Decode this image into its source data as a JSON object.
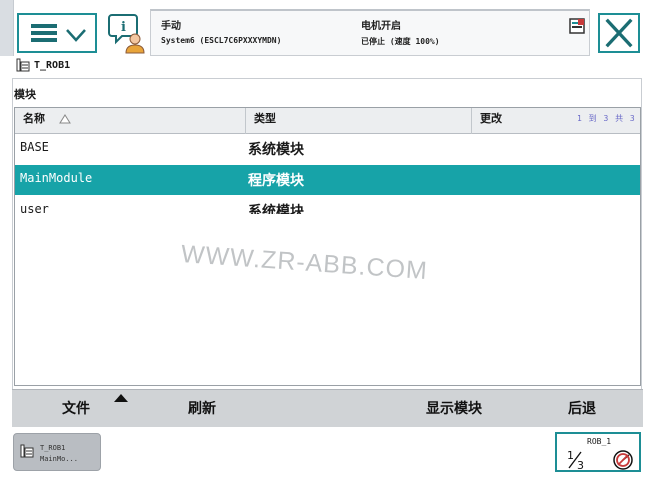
{
  "status": {
    "mode": "手动",
    "system": "System6 (ESCL7C6PXXXYMDN)",
    "motor": "电机开启",
    "state": "已停止 (速度 100%)"
  },
  "task": {
    "name": "T_ROB1"
  },
  "section": {
    "label": "模块"
  },
  "table": {
    "columns": [
      "名称",
      "类型",
      "更改"
    ],
    "page_info": "1 到 3 共 3",
    "rows": [
      {
        "name": "BASE",
        "type": "系统模块",
        "selected": false
      },
      {
        "name": "MainModule",
        "type": "程序模块",
        "selected": true
      },
      {
        "name": "user",
        "type": "系统模块",
        "selected": false
      }
    ]
  },
  "watermark": "WWW.ZR-ABB.COM",
  "commands": {
    "file": "文件",
    "refresh": "刷新",
    "show_module": "显示模块",
    "back": "后退"
  },
  "taskbar": {
    "tab_line1": "T_ROB1",
    "tab_line2": "MainMo...",
    "quickset_label": "ROB_1"
  },
  "colors": {
    "accent": "#1d8e95",
    "selection": "#17a3a8",
    "command_bar": "#d0d3d6"
  },
  "icons": {
    "menu": "hamburger-chevron-icon",
    "info": "info-person-icon",
    "close": "close-icon",
    "task": "task-program-icon",
    "sort": "sort-ascending-icon",
    "quickset_fraction": "one-third-icon",
    "quickset_speed": "speed-gauge-icon"
  }
}
